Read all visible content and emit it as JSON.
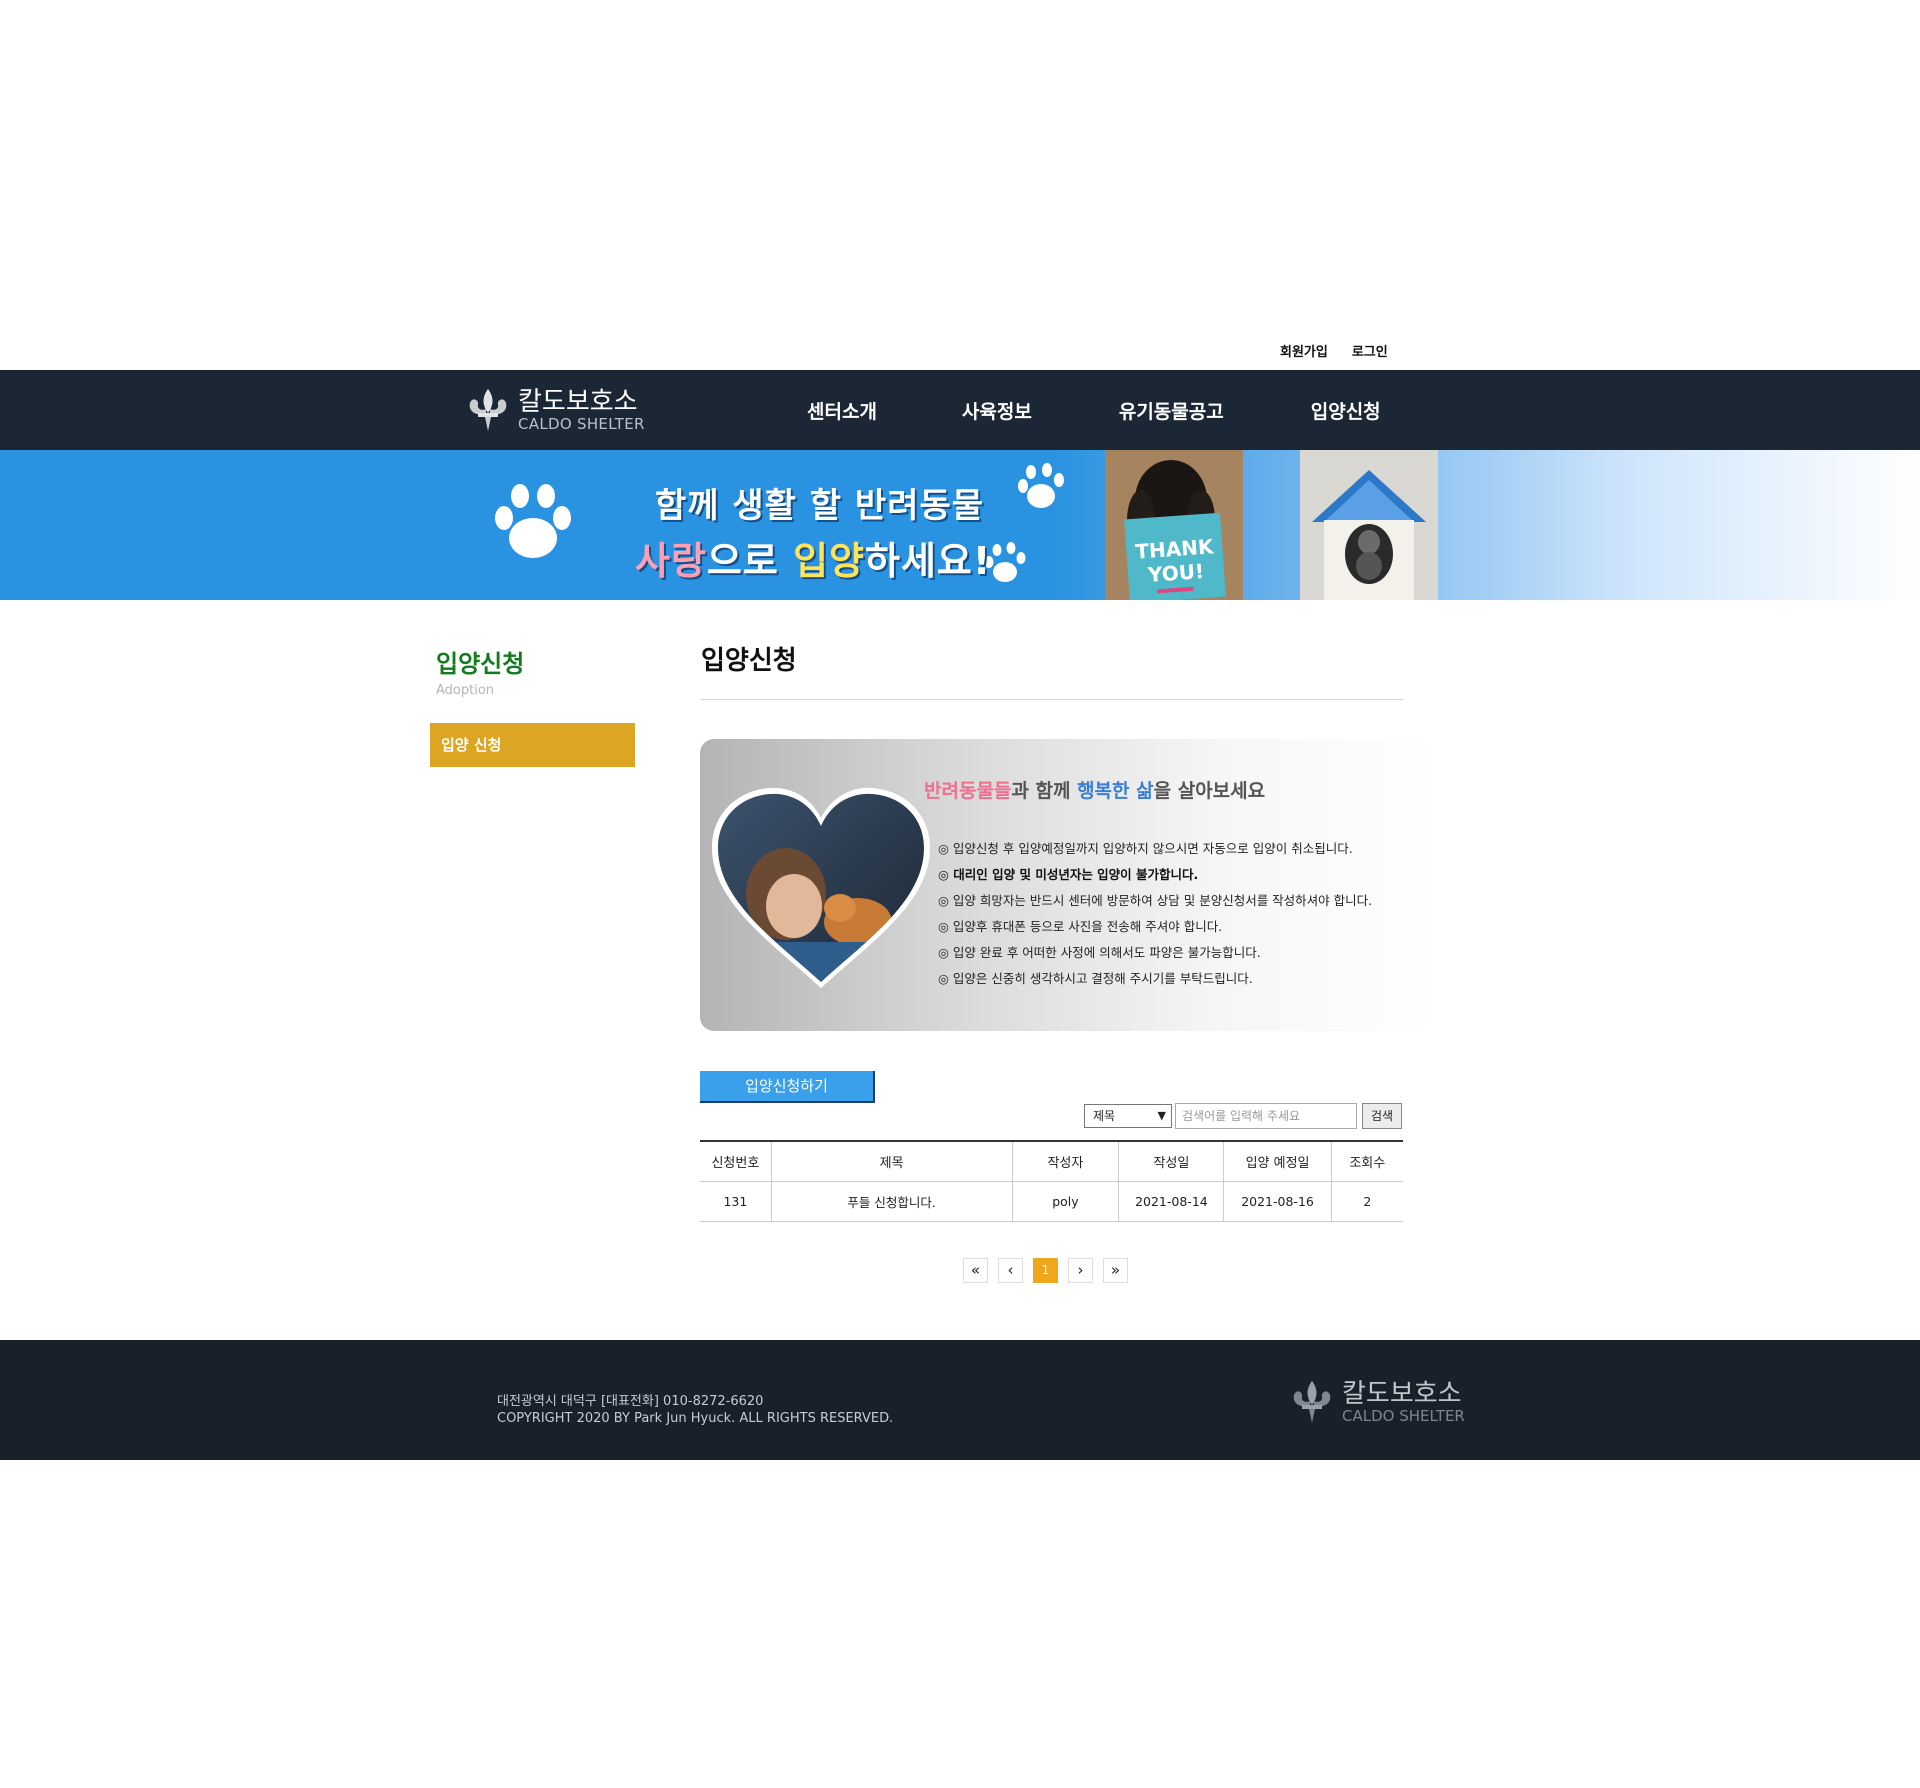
{
  "util_links": {
    "signup": "회원가입",
    "login": "로그인"
  },
  "brand": {
    "name_ko": "칼도보호소",
    "name_en": "CALDO SHELTER"
  },
  "nav": {
    "items": [
      "센터소개",
      "사육정보",
      "유기동물공고",
      "입양신청"
    ]
  },
  "banner": {
    "line1": "함께 생활 할 반려동물",
    "line2_a": "사랑",
    "line2_b": "으로 ",
    "line2_c": "입양",
    "line2_d": "하세요!",
    "sign_text": "THANK YOU!"
  },
  "sidebar": {
    "title": "입양신청",
    "subtitle": "Adoption",
    "menu_item": "입양 신청"
  },
  "main": {
    "title": "입양신청",
    "info_headline": {
      "p1": "반려동물들",
      "p2": "과 함께 ",
      "p3": "행복한 삶",
      "p4": "을 살아보세요"
    },
    "notices": [
      "◎ 입양신청 후 입양예정일까지 입양하지 않으시면 자동으로 입양이 취소됩니다.",
      "◎ 대리인 입양 및 미성년자는 입양이 불가합니다.",
      "◎ 입양 희망자는 반드시 센터에 방문하여 상담 및 분양신청서를 작성하셔야 합니다.",
      "◎ 입양후 휴대폰 등으로 사진을 전송해 주셔야 합니다.",
      "◎ 입양 완료 후 어떠한 사정에 의해서도 파양은 불가능합니다.",
      "◎ 입양은 신중히 생각하시고 결정해 주시기를 부탁드립니다."
    ],
    "apply_button": "입양신청하기",
    "search": {
      "select_value": "제목",
      "placeholder": "검색어를 입력해 주세요",
      "button": "검색"
    },
    "table": {
      "headers": [
        "신청번호",
        "제목",
        "작성자",
        "작성일",
        "입양 예정일",
        "조회수"
      ],
      "rows": [
        [
          "131",
          "푸들 신청합니다.",
          "poly",
          "2021-08-14",
          "2021-08-16",
          "2"
        ]
      ]
    },
    "pagination": {
      "first": "«",
      "prev": "‹",
      "current": "1",
      "next": "›",
      "last": "»"
    }
  },
  "footer": {
    "address": "대전광역시 대덕구 [대표전화] 010-8272-6620",
    "copyright": "COPYRIGHT 2020 BY Park Jun Hyuck. ALL RIGHTS RESERVED."
  },
  "colors": {
    "header_bg": "#1c2735",
    "banner_blue": "#2a93e1",
    "sidebar_active": "#dca522",
    "sidebar_title": "#137a1e",
    "apply_button": "#3aa0ec",
    "page_active": "#f0a61d",
    "footer_bg": "#18202b"
  }
}
